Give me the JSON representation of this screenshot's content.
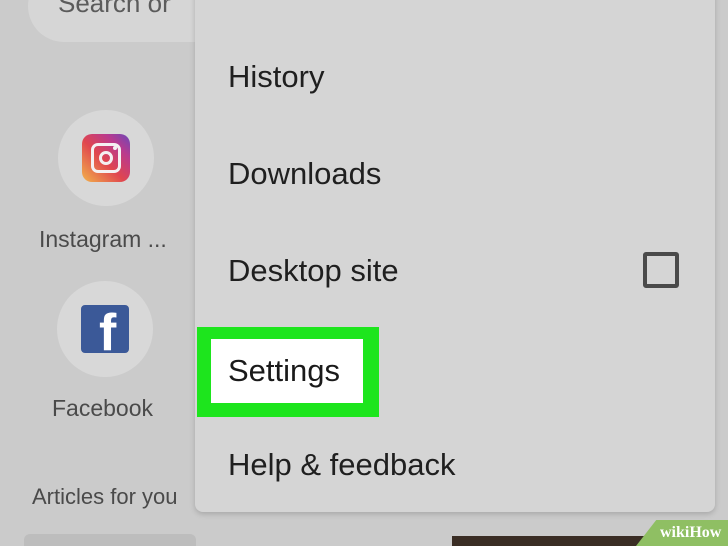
{
  "search": {
    "placeholder_partial": "Search or"
  },
  "shortcuts": [
    {
      "label": "Instagram ...",
      "icon": "instagram-icon"
    },
    {
      "label": "Facebook",
      "icon": "facebook-icon"
    }
  ],
  "feed": {
    "section_label": "Articles for you"
  },
  "menu": {
    "items": [
      {
        "label": "History"
      },
      {
        "label": "Downloads"
      },
      {
        "label": "Desktop site",
        "checkbox_checked": false
      },
      {
        "label": "Settings",
        "highlighted": true
      },
      {
        "label": "Help & feedback"
      }
    ]
  },
  "watermark": {
    "prefix": "wiki",
    "suffix": "How"
  },
  "colors": {
    "highlight": "#1de51d",
    "facebook_blue": "#3b5998",
    "watermark_green": "#8fbf63"
  }
}
